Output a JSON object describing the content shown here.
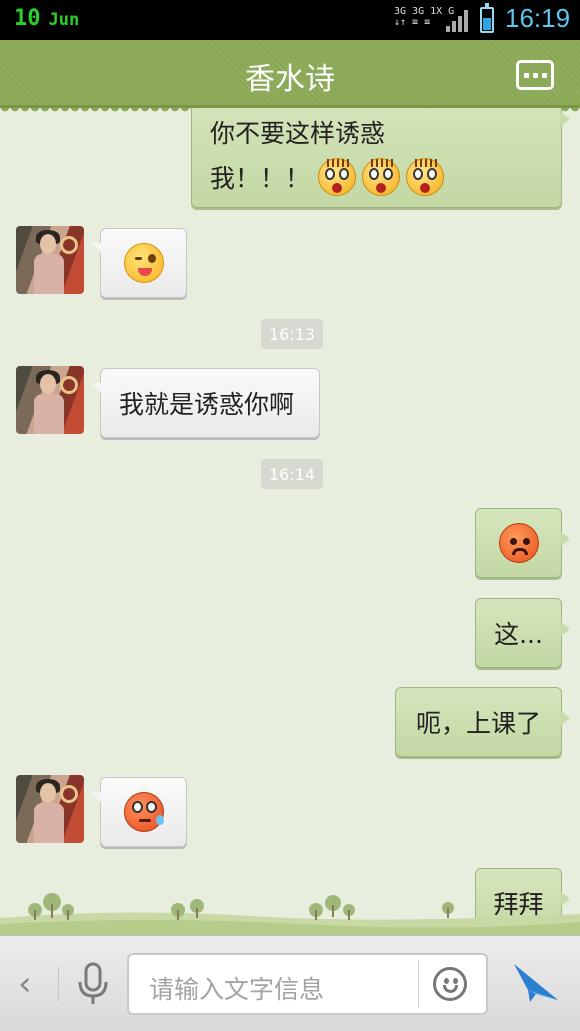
{
  "status_bar": {
    "day": "10",
    "month": "Jun",
    "network_line1": "3G 3G 1X G",
    "network_line2": "↓↑ ≡ ≡ ",
    "time": "16:19"
  },
  "header": {
    "title": "香水诗",
    "menu_icon": "more-options-icon"
  },
  "messages": [
    {
      "side": "out",
      "text_line1": "你不要这样诱惑",
      "text_line2": "我！！！",
      "emoji": [
        "shocked-emoji",
        "shocked-emoji",
        "shocked-emoji"
      ]
    },
    {
      "side": "in",
      "emoji": "wink-tongue-emoji"
    },
    {
      "type": "timestamp",
      "text": "16:13"
    },
    {
      "side": "in",
      "text": "我就是诱惑你啊"
    },
    {
      "type": "timestamp",
      "text": "16:14"
    },
    {
      "side": "out",
      "emoji": "angry-emoji"
    },
    {
      "side": "out",
      "text": "这..."
    },
    {
      "side": "out",
      "text": "呃，上课了"
    },
    {
      "side": "in",
      "emoji": "sweat-emoji"
    },
    {
      "side": "out",
      "text": "拜拜"
    }
  ],
  "input_bar": {
    "placeholder": "请输入文字信息",
    "back_icon": "chevron-left-icon",
    "mic_icon": "microphone-icon",
    "emoji_icon": "smiley-icon",
    "send_icon": "send-icon"
  },
  "colors": {
    "header_green": "#8fad5c",
    "outgoing_bubble": "#c9dcaa",
    "incoming_bubble": "#f4f4f4",
    "chat_bg": "#e8eedd",
    "time_blue": "#5ec4f0"
  }
}
